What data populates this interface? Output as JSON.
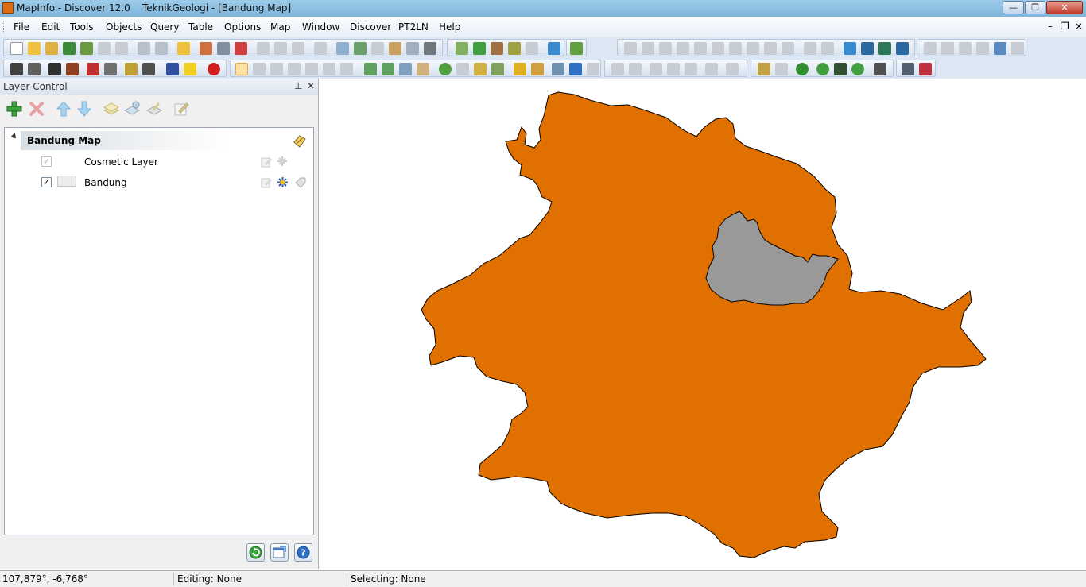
{
  "window": {
    "title": "MapInfo - Discover 12.0    TeknikGeologi - [Bandung Map]",
    "minimize_label": "—",
    "maximize_label": "❐",
    "close_label": "✕"
  },
  "menu": {
    "items": [
      "File",
      "Edit",
      "Tools",
      "Objects",
      "Query",
      "Table",
      "Options",
      "Map",
      "Window",
      "Discover",
      "PT2LN",
      "Help"
    ],
    "mdi_minimize": "–",
    "mdi_restore": "❐",
    "mdi_close": "×"
  },
  "layer_control": {
    "title": "Layer Control",
    "pin_label": "⊥",
    "close_label": "✕",
    "map_name": "Bandung Map",
    "layers": [
      {
        "name": "Cosmetic Layer",
        "visible": true,
        "check_mark": "✓"
      },
      {
        "name": "Bandung",
        "visible": true,
        "check_mark": "✓"
      }
    ]
  },
  "map": {
    "region_fill": "#e07000",
    "subregion_fill": "#999999",
    "outline": "#000000"
  },
  "status": {
    "coordinates": "107,879°, -6,768°",
    "editing": "Editing: None",
    "selecting": "Selecting: None"
  },
  "colors": {
    "titlebar": "#8cc0e4",
    "toolbar_bg": "#dde7f3",
    "accent_green": "#3ca23c",
    "accent_red": "#d03030",
    "accent_blue": "#2f7fd0"
  }
}
